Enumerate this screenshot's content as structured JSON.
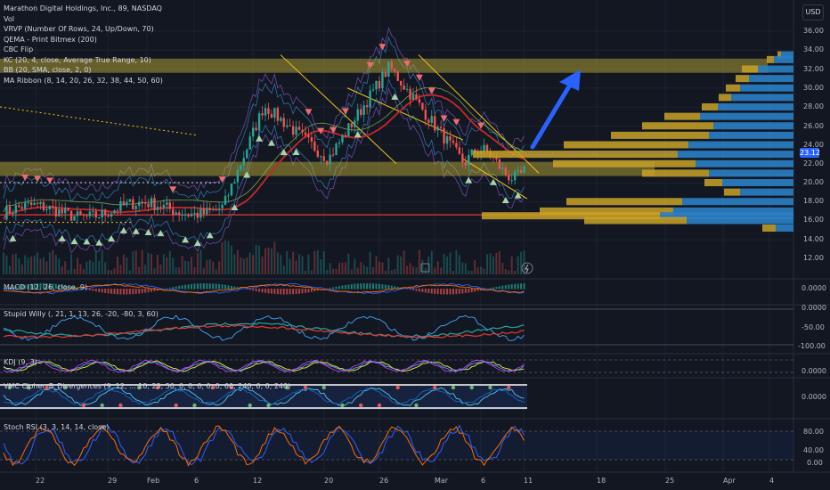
{
  "legend": {
    "symbol_line": "Marathon Digital Holdings, Inc., 89, NASDAQ",
    "indicators": [
      "Vol",
      "VRVP (Number Of Rows, 24, Up/Down, 70)",
      "QEMA - Print Bitmex (200)",
      "CBC Flip",
      "KC (20, 4, close, Average True Range, 10)",
      "BB (20, SMA, close, 2, 0)",
      "MA Ribbon (8, 14, 20, 26, 32, 38, 44, 50, 60)"
    ]
  },
  "currency_button": "USD",
  "price_axis": {
    "labels": [
      "36.00",
      "34.00",
      "32.00",
      "30.00",
      "28.00",
      "26.00",
      "24.00",
      "22.00",
      "20.00",
      "18.00",
      "16.00",
      "14.00",
      "12.00"
    ],
    "current_price": "23.12"
  },
  "panes": {
    "macd": {
      "label": "MACD (12, 26, close, 9)",
      "axis": [
        "0.0000"
      ]
    },
    "stupid_willy": {
      "label": "Stupid Willy (, 21, 1, 13, 26, -20, -80, 3, 60)",
      "axis": [
        "0.0000",
        "-50.00",
        "-100.00"
      ]
    },
    "kdj": {
      "label": "KDJ (9, 3)",
      "axis": [
        "0.0000"
      ]
    },
    "vmc": {
      "label": "VMC Cipher_B_Divergences (9, 12, ...  10, 23, 50, 0, 0, 0, 0, 0, 60, 240, 0, 0, 240)",
      "axis": [
        "0.0000"
      ]
    },
    "stoch_rsi": {
      "label": "Stoch RSI (3, 3, 14, 14, close)",
      "axis": [
        "80.00",
        "40.00",
        "0.00"
      ]
    }
  },
  "time_axis": [
    "22",
    "29",
    "Feb",
    "6",
    "12",
    "20",
    "26",
    "Mar",
    "6",
    "11",
    "18",
    "25",
    "Apr",
    "4"
  ],
  "colors": {
    "background": "#131722",
    "zone": "#c9b83a",
    "up": "#26a69a",
    "down": "#ef5350",
    "arrow": "#2962ff",
    "vrvp_up": "#2a7fc4",
    "vrvp_down": "#c9a227"
  }
}
